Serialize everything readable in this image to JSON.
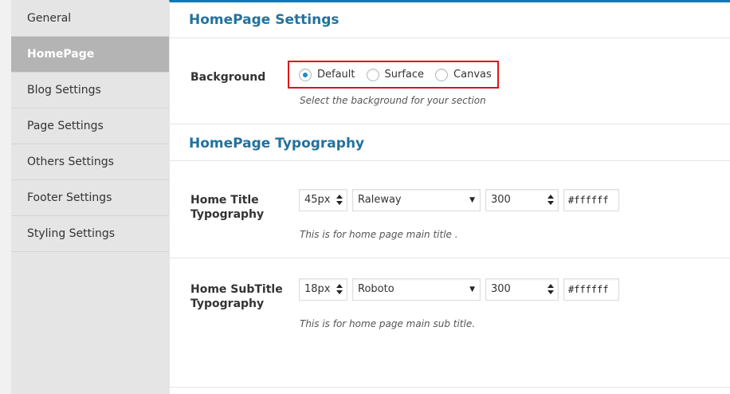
{
  "sidebar": {
    "items": [
      {
        "label": "General",
        "active": false
      },
      {
        "label": "HomePage",
        "active": true
      },
      {
        "label": "Blog Settings",
        "active": false
      },
      {
        "label": "Page Settings",
        "active": false
      },
      {
        "label": "Others Settings",
        "active": false
      },
      {
        "label": "Footer Settings",
        "active": false
      },
      {
        "label": "Styling Settings",
        "active": false
      }
    ]
  },
  "homepage_settings": {
    "title": "HomePage Settings",
    "background": {
      "label": "Background",
      "options": [
        "Default",
        "Surface",
        "Canvas"
      ],
      "selected": "Default",
      "description": "Select the background for your section"
    }
  },
  "typography": {
    "title": "HomePage Typography",
    "home_title": {
      "label_line1": "Home Title",
      "label_line2": "Typography",
      "size": "45px",
      "font": "Raleway",
      "weight": "300",
      "color": "#ffffff",
      "description": "This is for home page main title ."
    },
    "home_subtitle": {
      "label_line1": "Home SubTitle",
      "label_line2": "Typography",
      "size": "18px",
      "font": "Roboto",
      "weight": "300",
      "color": "#ffffff",
      "description": "This is for home page main sub title."
    }
  },
  "colors": {
    "accent": "#0b7ab8",
    "title": "#23729c",
    "highlight": "#e0131a",
    "sidebar_active": "#b4b4b4"
  }
}
